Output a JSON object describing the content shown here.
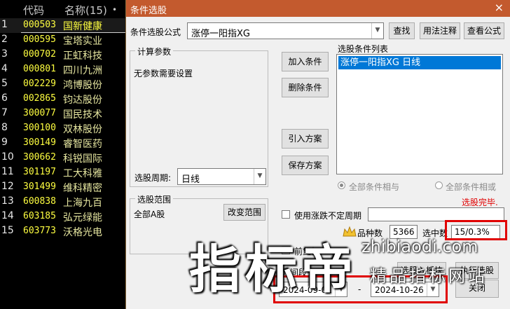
{
  "stock_list": {
    "header": {
      "code": "代码",
      "name": "名称(15)",
      "dot": "•"
    },
    "rows": [
      {
        "idx": "1",
        "code": "000503",
        "name": "国新健康"
      },
      {
        "idx": "2",
        "code": "000595",
        "name": "宝塔实业"
      },
      {
        "idx": "3",
        "code": "000702",
        "name": "正虹科技"
      },
      {
        "idx": "4",
        "code": "000801",
        "name": "四川九洲"
      },
      {
        "idx": "5",
        "code": "002229",
        "name": "鸿博股份"
      },
      {
        "idx": "6",
        "code": "002865",
        "name": "钧达股份"
      },
      {
        "idx": "7",
        "code": "300077",
        "name": "国民技术"
      },
      {
        "idx": "8",
        "code": "300100",
        "name": "双林股份"
      },
      {
        "idx": "9",
        "code": "300149",
        "name": "睿智医药"
      },
      {
        "idx": "10",
        "code": "300662",
        "name": "科锐国际"
      },
      {
        "idx": "11",
        "code": "301197",
        "name": "工大科雅"
      },
      {
        "idx": "12",
        "code": "301499",
        "name": "维科精密"
      },
      {
        "idx": "13",
        "code": "600838",
        "name": "上海九百"
      },
      {
        "idx": "14",
        "code": "603185",
        "name": "弘元绿能"
      },
      {
        "idx": "15",
        "code": "603773",
        "name": "沃格光电"
      }
    ]
  },
  "dialog": {
    "title": "条件选股",
    "close_glyph": "×",
    "formula_label": "条件选股公式",
    "formula_value": "涨停一阳指XG",
    "buttons": {
      "find": "查找",
      "usage_notes": "用法注释",
      "view_formula": "查看公式",
      "add_condition": "加入条件",
      "delete_condition": "删除条件",
      "import_plan": "引入方案",
      "save_plan": "保存方案",
      "change_range": "改变范围",
      "select_to_board": "选股入板块",
      "execute": "执行选股",
      "close": "关闭"
    },
    "calc_params": {
      "legend": "计算参数",
      "message": "无参数需要设置",
      "period_label": "选股周期:",
      "period_value": "日线"
    },
    "cond_list": {
      "legend": "选股条件列表",
      "items": [
        "涨停一阳指XG  日线"
      ]
    },
    "radios": {
      "and": "全部条件相与",
      "or": "全部条件相或"
    },
    "status": "选股完毕.",
    "range": {
      "legend": "选股范围",
      "value": "全部A股"
    },
    "indeterminate_period_label": "使用涨跌不定周期",
    "stats": {
      "count_label": "品种数",
      "count_value": "5366",
      "hit_label": "选中数",
      "hit_value": "15/0.3%"
    },
    "forward_adjust_label": "前复权",
    "time_label": "时间段",
    "date_from": "2024-09-01",
    "date_sep": "-",
    "date_to": "2024-10-26",
    "watermark": {
      "big": "指标帝",
      "url": "zhibiaodi.com",
      "sub": "精品指标网站"
    }
  },
  "colors": {
    "titlebar": "#c35a2e",
    "code_yellow": "#ffff40",
    "status_red": "#e00000",
    "list_select_blue": "#0078d7"
  }
}
